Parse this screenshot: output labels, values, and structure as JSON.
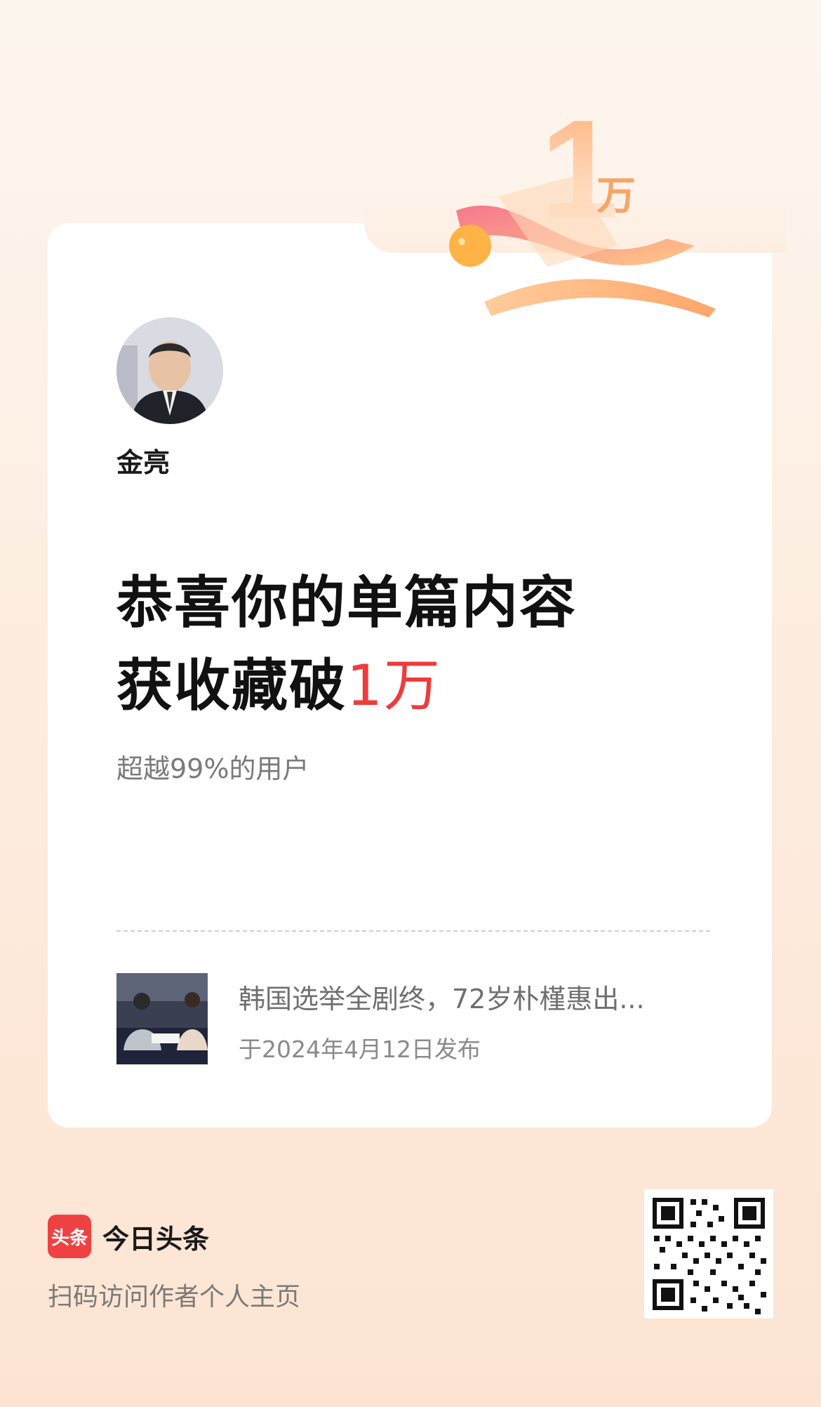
{
  "author": {
    "name": "金亮"
  },
  "badge": {
    "number": "1",
    "unit": "万"
  },
  "headline": {
    "line1": "恭喜你的单篇内容",
    "line2_prefix": "获收藏破",
    "highlight": "1万"
  },
  "subtitle": "超越99%的用户",
  "article": {
    "title": "韩国选举全剧终，72岁朴槿惠出...",
    "date": "于2024年4月12日发布"
  },
  "footer": {
    "brand_logo_text": "头条",
    "brand_name": "今日头条",
    "hint": "扫码访问作者个人主页"
  },
  "colors": {
    "accent": "#ee3b3b",
    "brand": "#f04142"
  }
}
